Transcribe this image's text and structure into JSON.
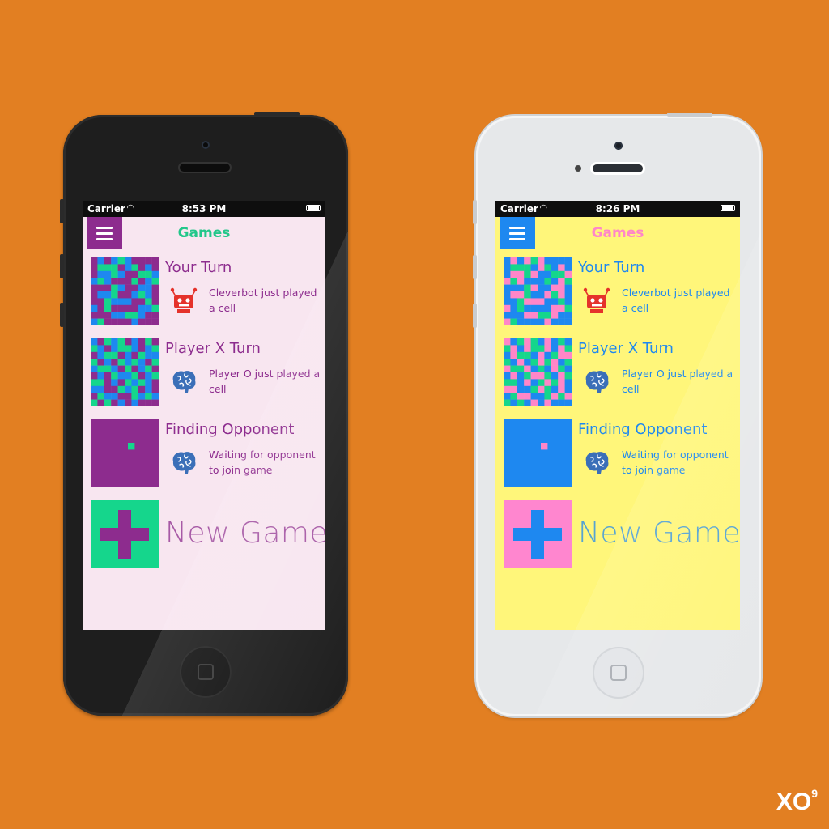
{
  "phones": [
    {
      "status": {
        "carrier": "Carrier",
        "wifi": "wifi-icon",
        "time": "8:53 PM"
      },
      "nav": {
        "title": "Games"
      },
      "colors": {
        "bg": "#f8e6f0",
        "accent": "#8d2c8e",
        "title": "#22c78a",
        "sub": "#8d2c8e",
        "new_bg": "#15d68c",
        "new_fg": "#8d2c8e",
        "finding_bg": "#8d2c8e",
        "finding_dot": "#15d68c",
        "grid": [
          "#8d2c8e",
          "#1e88f0",
          "#15d68c"
        ],
        "robot": "#e5322b",
        "brain": "#3b6fb8"
      },
      "games": [
        {
          "title": "Your Turn",
          "icon": "robot-icon",
          "subtitle": "Cleverbot just played a cell"
        },
        {
          "title": "Player X Turn",
          "icon": "brain-icon",
          "subtitle": "Player O just played a cell"
        },
        {
          "title": "Finding Opponent",
          "icon": "brain-icon",
          "subtitle": "Waiting for opponent to join game"
        }
      ],
      "new_game": "New Game"
    },
    {
      "status": {
        "carrier": "Carrier",
        "wifi": "wifi-icon",
        "time": "8:26 PM"
      },
      "nav": {
        "title": "Games"
      },
      "colors": {
        "bg": "#fff67a",
        "accent": "#1e88f0",
        "title": "#ff86c8",
        "sub": "#1e88f0",
        "new_bg": "#ff86cf",
        "new_fg": "#1e88f0",
        "finding_bg": "#1e88f0",
        "finding_dot": "#ff86c8",
        "grid": [
          "#1e88f0",
          "#ff86c8",
          "#15d68c"
        ],
        "robot": "#e5322b",
        "brain": "#3b6fb8"
      },
      "games": [
        {
          "title": "Your Turn",
          "icon": "robot-icon",
          "subtitle": "Cleverbot just played a cell"
        },
        {
          "title": "Player X Turn",
          "icon": "brain-icon",
          "subtitle": "Player O just played a cell"
        },
        {
          "title": "Finding Opponent",
          "icon": "brain-icon",
          "subtitle": "Waiting for opponent to join game"
        }
      ],
      "new_game": "New Game"
    }
  ],
  "brand": {
    "logo": "XO",
    "superscript": "9"
  }
}
